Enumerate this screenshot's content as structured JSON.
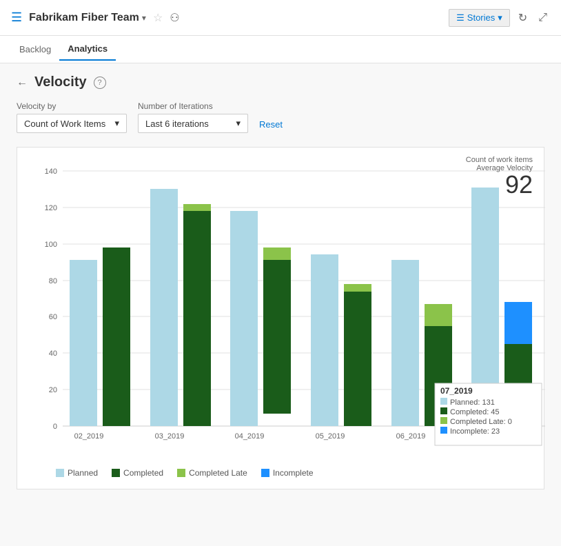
{
  "header": {
    "icon": "☰",
    "title": "Fabrikam Fiber Team",
    "chevron": "▾",
    "star": "☆",
    "people_icon": "👥",
    "stories_label": "Stories",
    "stories_chevron": "▾",
    "refresh_label": "↻",
    "expand_label": "⤢"
  },
  "nav": {
    "backlog_label": "Backlog",
    "analytics_label": "Analytics"
  },
  "page": {
    "back_label": "←",
    "title": "Velocity",
    "help_label": "?",
    "velocity_by_label": "Velocity by",
    "velocity_by_value": "Count of Work Items",
    "iterations_label": "Number of Iterations",
    "iterations_value": "Last 6 iterations",
    "reset_label": "Reset",
    "count_label": "Count of work items",
    "avg_velocity_label": "Average Velocity",
    "avg_velocity_value": "92"
  },
  "legend": [
    {
      "label": "Planned",
      "color": "#add8e6"
    },
    {
      "label": "Completed",
      "color": "#1a5c1a"
    },
    {
      "label": "Completed Late",
      "color": "#8bc34a"
    },
    {
      "label": "Incomplete",
      "color": "#1e90ff"
    }
  ],
  "tooltip": {
    "title": "07_2019",
    "rows": [
      {
        "label": "Planned: 131",
        "color": "#add8e6"
      },
      {
        "label": "Completed: 45",
        "color": "#1a5c1a"
      },
      {
        "label": "Completed Late: 0",
        "color": "#8bc34a"
      },
      {
        "label": "Incomplete: 23",
        "color": "#1e90ff"
      }
    ]
  },
  "chart": {
    "y_max": 140,
    "y_ticks": [
      0,
      20,
      40,
      60,
      80,
      100,
      120,
      140
    ],
    "bars": [
      {
        "label": "02_2019",
        "planned": 91,
        "completed": 98,
        "completed_late": 0,
        "incomplete": 0
      },
      {
        "label": "03_2019",
        "planned": 130,
        "completed": 118,
        "completed_late": 0,
        "incomplete": 0
      },
      {
        "label": "04_2019",
        "planned": 118,
        "completed": 84,
        "completed_late": 7,
        "incomplete": 0
      },
      {
        "label": "05_2019",
        "planned": 94,
        "completed": 74,
        "completed_late": 4,
        "incomplete": 0
      },
      {
        "label": "06_2019",
        "planned": 91,
        "completed": 55,
        "completed_late": 12,
        "incomplete": 0
      },
      {
        "label": "07_2019",
        "planned": 131,
        "completed": 45,
        "completed_late": 0,
        "incomplete": 23
      }
    ]
  }
}
